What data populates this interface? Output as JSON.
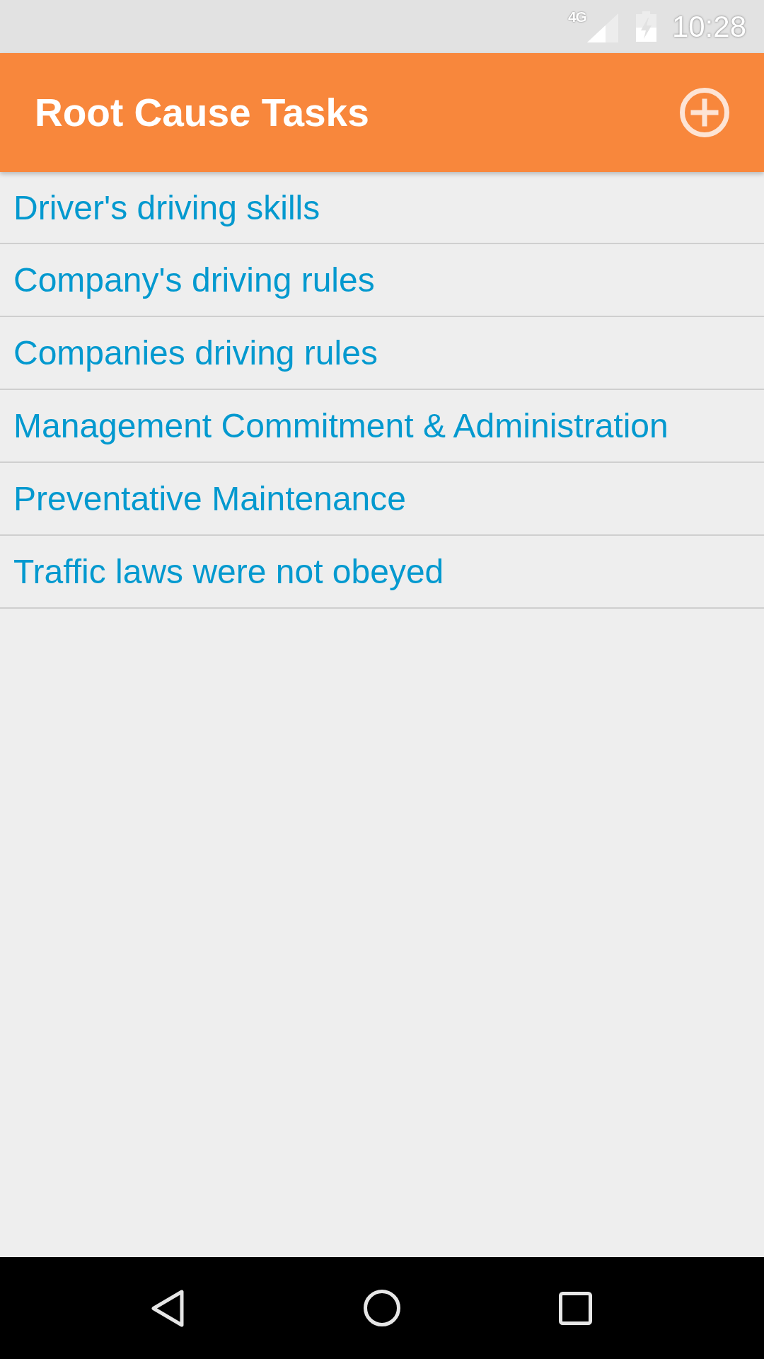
{
  "status_bar": {
    "network_type": "4G",
    "time": "10:28"
  },
  "app_bar": {
    "title": "Root Cause Tasks"
  },
  "tasks": [
    "Driver's driving skills",
    "Company's driving rules",
    "Companies driving rules",
    "Management Commitment & Administration",
    "Preventative Maintenance",
    "Traffic laws were not obeyed"
  ]
}
